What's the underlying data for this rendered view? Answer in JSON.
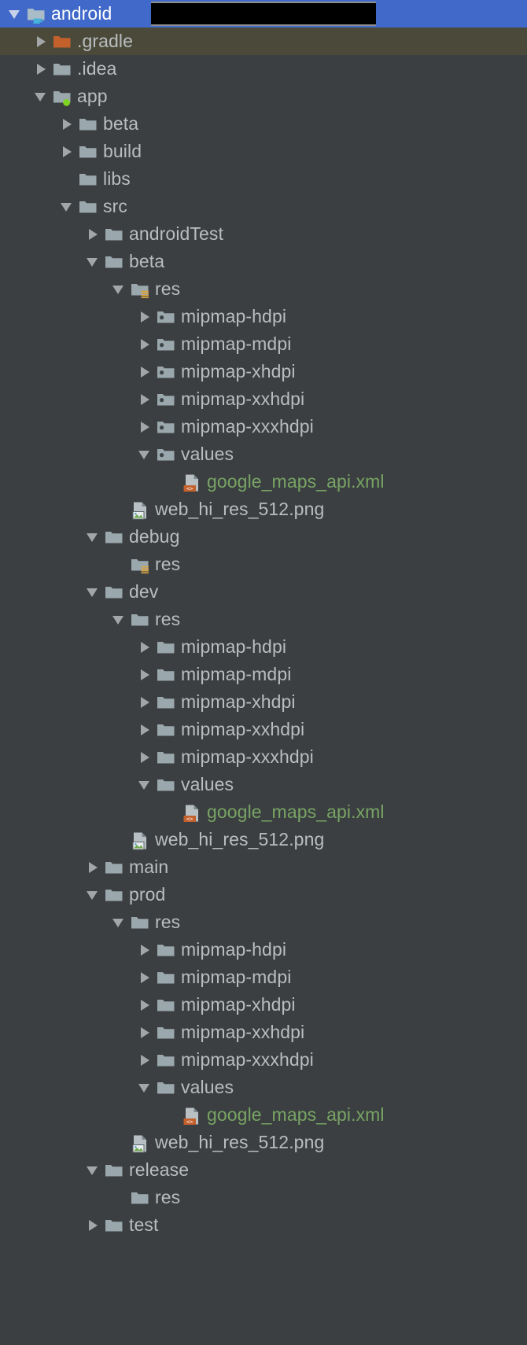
{
  "window": {
    "title": "android",
    "background_color": "#3c3f41",
    "selection_color": "#4169c9",
    "hover_color": "#4b4a3a",
    "text_color": "#b9bdc0",
    "xml_text_color": "#77a464"
  },
  "tree": {
    "name": "project-tree",
    "rows": [
      {
        "label": "android",
        "depth": 0,
        "twisty": "expanded",
        "icon": "folder-module-icon",
        "state": "selected",
        "redacted": true,
        "style": "root"
      },
      {
        "label": ".gradle",
        "depth": 1,
        "twisty": "collapsed",
        "icon": "folder-orange-icon",
        "state": "hovered"
      },
      {
        "label": ".idea",
        "depth": 1,
        "twisty": "collapsed",
        "icon": "folder-icon"
      },
      {
        "label": "app",
        "depth": 1,
        "twisty": "expanded",
        "icon": "folder-module-green-icon"
      },
      {
        "label": "beta",
        "depth": 2,
        "twisty": "collapsed",
        "icon": "folder-icon"
      },
      {
        "label": "build",
        "depth": 2,
        "twisty": "collapsed",
        "icon": "folder-icon"
      },
      {
        "label": "libs",
        "depth": 2,
        "twisty": "none",
        "icon": "folder-icon"
      },
      {
        "label": "src",
        "depth": 2,
        "twisty": "expanded",
        "icon": "folder-icon"
      },
      {
        "label": "androidTest",
        "depth": 3,
        "twisty": "collapsed",
        "icon": "folder-icon"
      },
      {
        "label": "beta",
        "depth": 3,
        "twisty": "expanded",
        "icon": "folder-icon"
      },
      {
        "label": "res",
        "depth": 4,
        "twisty": "expanded",
        "icon": "folder-res-icon"
      },
      {
        "label": "mipmap-hdpi",
        "depth": 5,
        "twisty": "collapsed",
        "icon": "folder-mipmap-icon"
      },
      {
        "label": "mipmap-mdpi",
        "depth": 5,
        "twisty": "collapsed",
        "icon": "folder-mipmap-icon"
      },
      {
        "label": "mipmap-xhdpi",
        "depth": 5,
        "twisty": "collapsed",
        "icon": "folder-mipmap-icon"
      },
      {
        "label": "mipmap-xxhdpi",
        "depth": 5,
        "twisty": "collapsed",
        "icon": "folder-mipmap-icon"
      },
      {
        "label": "mipmap-xxxhdpi",
        "depth": 5,
        "twisty": "collapsed",
        "icon": "folder-mipmap-icon"
      },
      {
        "label": "values",
        "depth": 5,
        "twisty": "expanded",
        "icon": "folder-mipmap-icon"
      },
      {
        "label": "google_maps_api.xml",
        "depth": 6,
        "twisty": "none",
        "icon": "file-xml-icon",
        "style": "xmlfile"
      },
      {
        "label": "web_hi_res_512.png",
        "depth": 4,
        "twisty": "none",
        "icon": "file-png-icon",
        "style": "pngfile"
      },
      {
        "label": "debug",
        "depth": 3,
        "twisty": "expanded",
        "icon": "folder-icon"
      },
      {
        "label": "res",
        "depth": 4,
        "twisty": "none",
        "icon": "folder-res-icon"
      },
      {
        "label": "dev",
        "depth": 3,
        "twisty": "expanded",
        "icon": "folder-icon"
      },
      {
        "label": "res",
        "depth": 4,
        "twisty": "expanded",
        "icon": "folder-icon"
      },
      {
        "label": "mipmap-hdpi",
        "depth": 5,
        "twisty": "collapsed",
        "icon": "folder-icon"
      },
      {
        "label": "mipmap-mdpi",
        "depth": 5,
        "twisty": "collapsed",
        "icon": "folder-icon"
      },
      {
        "label": "mipmap-xhdpi",
        "depth": 5,
        "twisty": "collapsed",
        "icon": "folder-icon"
      },
      {
        "label": "mipmap-xxhdpi",
        "depth": 5,
        "twisty": "collapsed",
        "icon": "folder-icon"
      },
      {
        "label": "mipmap-xxxhdpi",
        "depth": 5,
        "twisty": "collapsed",
        "icon": "folder-icon"
      },
      {
        "label": "values",
        "depth": 5,
        "twisty": "expanded",
        "icon": "folder-icon"
      },
      {
        "label": "google_maps_api.xml",
        "depth": 6,
        "twisty": "none",
        "icon": "file-xml-icon",
        "style": "xmlfile"
      },
      {
        "label": "web_hi_res_512.png",
        "depth": 4,
        "twisty": "none",
        "icon": "file-png-icon",
        "style": "pngfile"
      },
      {
        "label": "main",
        "depth": 3,
        "twisty": "collapsed",
        "icon": "folder-icon"
      },
      {
        "label": "prod",
        "depth": 3,
        "twisty": "expanded",
        "icon": "folder-icon"
      },
      {
        "label": "res",
        "depth": 4,
        "twisty": "expanded",
        "icon": "folder-icon"
      },
      {
        "label": "mipmap-hdpi",
        "depth": 5,
        "twisty": "collapsed",
        "icon": "folder-icon"
      },
      {
        "label": "mipmap-mdpi",
        "depth": 5,
        "twisty": "collapsed",
        "icon": "folder-icon"
      },
      {
        "label": "mipmap-xhdpi",
        "depth": 5,
        "twisty": "collapsed",
        "icon": "folder-icon"
      },
      {
        "label": "mipmap-xxhdpi",
        "depth": 5,
        "twisty": "collapsed",
        "icon": "folder-icon"
      },
      {
        "label": "mipmap-xxxhdpi",
        "depth": 5,
        "twisty": "collapsed",
        "icon": "folder-icon"
      },
      {
        "label": "values",
        "depth": 5,
        "twisty": "expanded",
        "icon": "folder-icon"
      },
      {
        "label": "google_maps_api.xml",
        "depth": 6,
        "twisty": "none",
        "icon": "file-xml-icon",
        "style": "xmlfile"
      },
      {
        "label": "web_hi_res_512.png",
        "depth": 4,
        "twisty": "none",
        "icon": "file-png-icon",
        "style": "pngfile"
      },
      {
        "label": "release",
        "depth": 3,
        "twisty": "expanded",
        "icon": "folder-icon"
      },
      {
        "label": "res",
        "depth": 4,
        "twisty": "none",
        "icon": "folder-icon"
      },
      {
        "label": "test",
        "depth": 3,
        "twisty": "collapsed",
        "icon": "folder-icon"
      }
    ]
  }
}
